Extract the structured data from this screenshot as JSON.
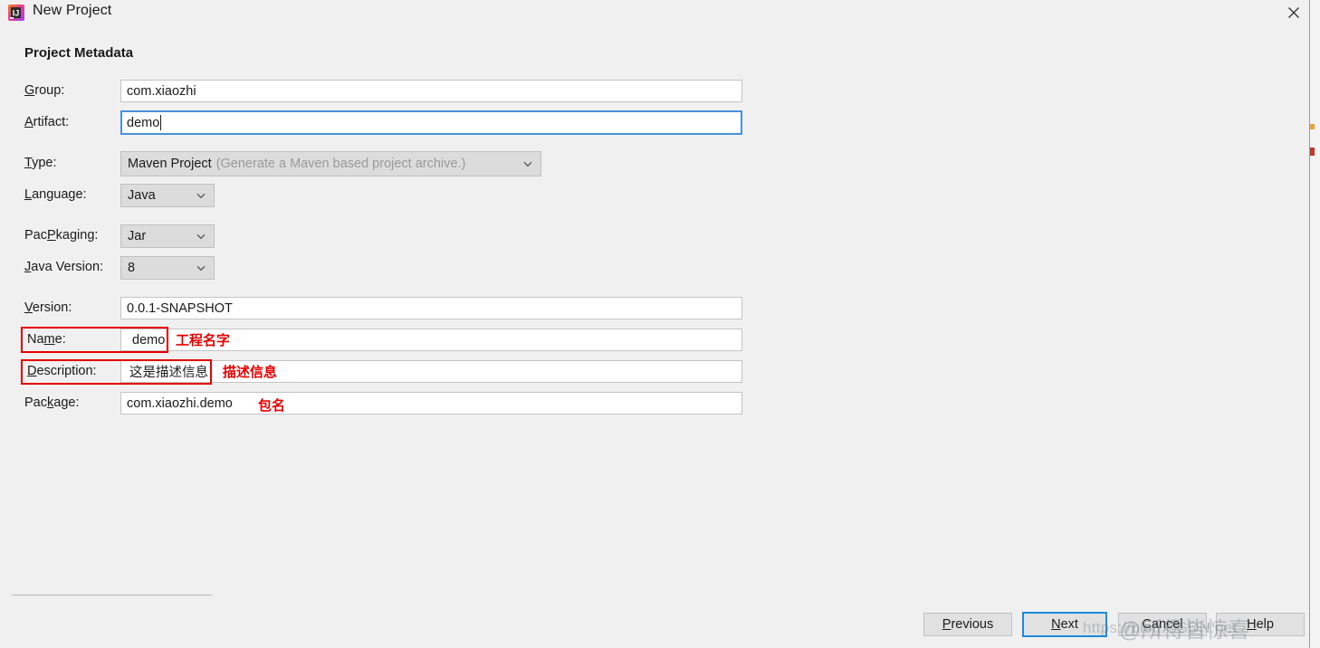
{
  "window": {
    "title": "New Project",
    "app_icon": "intellij-idea-icon",
    "close_icon": "close-icon"
  },
  "section": {
    "heading": "Project Metadata"
  },
  "fields": {
    "group": {
      "label": "Group:",
      "mnemonic": "G",
      "value": "com.xiaozhi"
    },
    "artifact": {
      "label": "Artifact:",
      "mnemonic": "A",
      "value": "demo",
      "focused": true
    },
    "type": {
      "label": "Type:",
      "mnemonic": "T",
      "value": "Maven Project",
      "hint": "(Generate a Maven based project archive.)"
    },
    "language": {
      "label": "Language:",
      "mnemonic": "L",
      "value": "Java"
    },
    "packaging": {
      "label": "Packaging:",
      "mnemonic": "P",
      "value": "Jar"
    },
    "java_version": {
      "label": "Java Version:",
      "mnemonic": "J",
      "value": "8"
    },
    "version": {
      "label": "Version:",
      "mnemonic": "V",
      "value": "0.0.1-SNAPSHOT"
    },
    "name": {
      "label": "Name:",
      "mnemonic": "m",
      "value": "demo"
    },
    "description": {
      "label": "Description:",
      "mnemonic": "D",
      "value": "这是描述信息"
    },
    "package": {
      "label": "Package:",
      "mnemonic": "k",
      "value": "com.xiaozhi.demo"
    }
  },
  "annotations": {
    "color": "#e60000",
    "name_note": "工程名字",
    "description_note": "描述信息",
    "package_note": "包名"
  },
  "buttons": {
    "previous": "Previous",
    "next": "Next",
    "cancel": "Cancel",
    "help": "Help"
  },
  "watermark": {
    "url": "https://blog.CSDN.net",
    "handle": "@所得皆惊喜"
  }
}
